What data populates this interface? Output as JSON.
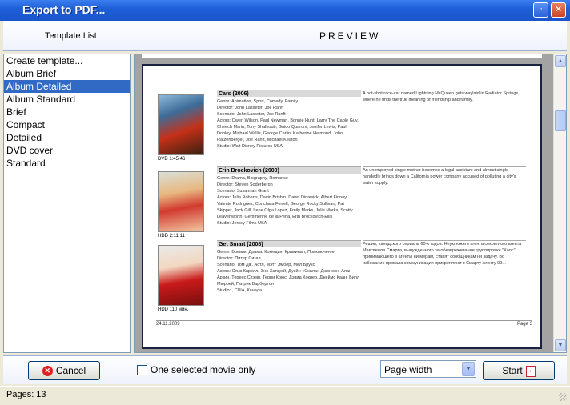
{
  "window": {
    "title": "Export to PDF...",
    "maximize_icon": "maximize-icon",
    "close_icon": "close-icon"
  },
  "header": {
    "left": "Template List",
    "right": "PREVIEW"
  },
  "templates": {
    "items": [
      "Create template...",
      "Album Brief",
      "Album Detailed",
      "Album Standard",
      "Brief",
      "Compact",
      "Detailed",
      "DVD cover",
      "Standard"
    ],
    "selected": "Album Detailed"
  },
  "preview": {
    "movies": [
      {
        "title": "Cars (2006)",
        "genre": "Genre: Animation, Sport, Comedy, Family",
        "director": "Director: John Lasseter, Joe Ranft",
        "scenario": "Scenario: John Lasseter, Joe Ranft",
        "actors": "Actors: Owen Wilson, Paul Newman, Bonnie Hunt, Larry The Cable Guy, Cheech Marin, Tony Shalhoub, Guido Quaroni, Jenifer Lewis, Paul Dooley, Michael Wallis, George Carlin, Katherine Helmond, John Ratzenberger, Joe Ranft, Michael Keaton",
        "studio": "Studio: Walt Disney Pictures USA",
        "desc": "A hot-shot race-car named Lightning McQueen gets waylaid in Radiator Springs, where he finds the true meaning of friendship and family.",
        "caption": "DVD 1:45:46"
      },
      {
        "title": "Erin Brockovich (2000)",
        "genre": "Genre: Drama, Biography, Romance",
        "director": "Director: Steven Soderbergh",
        "scenario": "Scenario: Susannah Grant",
        "actors": "Actors: Julia Roberts, David Brisbin, Dawn Didawick, Albert Finney, Valente Rodriguez, Conchata Ferrell, George Rocky Sullivan, Pat Skipper, Jack Gill, Irene Olga Lopez, Emily Marks, Julie Marks, Scotty Leavenworth, Gemmenne de la Pena, Erin Brockovich-Ellis",
        "studio": "Studio: Jersey Films USA",
        "desc": "An unemployed single mother becomes a legal assistant and almost single-handedly brings down a California power company accused of polluting a city's water supply.",
        "caption": "HDD 2:11:11"
      },
      {
        "title": "Get Smart (2008)",
        "genre": "Genre: Боевик, Драма, Комедия, Криминал, Приключения",
        "director": "Director: Питер Сигал",
        "scenario": "Scenario: Том Дж. Астл, Мэтт Эмбер, Мел Брукс",
        "actors": "Actors: Стив Карелл, Энн Хэтэуэй, Дуэйн «Скала» Джонсон, Алан Аркин, Теренс Стэмп, Терри Крюс, Дэвид Кокнер, Джеймс Каан, Билл Мюррей, Патрик Варбертон",
        "studio": "Studio: , США, Канада",
        "desc": "Решив, канадского сериала 60-х годов. Неуклюжего агента секретного агента Максвелла Смарта, вынужденного за обезвреживание группировки \"Хаос\", принимающего в агенты ни мерам, ставят сообщникам ни задачу. Во избежание провала коммуникации прикрепляют к Смарту Агенту 99...",
        "caption": "HDD 110 мин."
      }
    ],
    "footer_date": "24.11.2009",
    "footer_page": "Page 3"
  },
  "bottom": {
    "cancel_label": "Cancel",
    "checkbox_label": "One selected movie only",
    "checkbox_checked": false,
    "zoom_value": "Page width",
    "start_label": "Start"
  },
  "status": {
    "text": "Pages: 13"
  }
}
